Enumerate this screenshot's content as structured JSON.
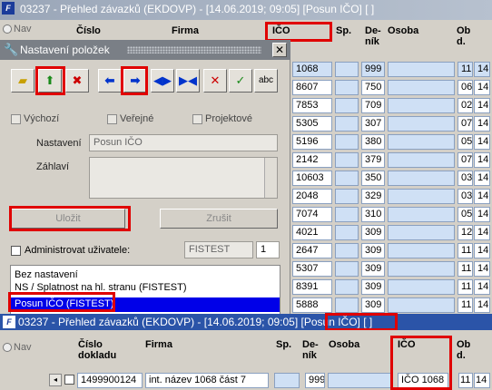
{
  "top_window": {
    "title": "03237 - Přehled závazků (EKDOVP) - [14.06.2019; 09:05] [Posun IČO] [ ]",
    "nav_label": "Nav",
    "columns": {
      "cislo": "Číslo",
      "firma": "Firma",
      "ico": "IČO",
      "sp": "Sp.",
      "den": "De-",
      "den2": "ník",
      "osoba": "Osoba",
      "ob": "Ob",
      "ob2": "d."
    },
    "rows": [
      {
        "den": "999",
        "ob": "11",
        "ob2": "14",
        "firma_tail": "1068"
      },
      {
        "den": "750",
        "ob": "06",
        "ob2": "14",
        "firma_tail": "8607"
      },
      {
        "den": "709",
        "ob": "02",
        "ob2": "14",
        "firma_tail": "7853"
      },
      {
        "den": "307",
        "ob": "07",
        "ob2": "14",
        "firma_tail": "5305"
      },
      {
        "den": "380",
        "ob": "05",
        "ob2": "14",
        "firma_tail": "5196"
      },
      {
        "den": "379",
        "ob": "07",
        "ob2": "14",
        "firma_tail": "2142"
      },
      {
        "den": "350",
        "ob": "03",
        "ob2": "14",
        "firma_tail": "10603"
      },
      {
        "den": "329",
        "ob": "03",
        "ob2": "14",
        "firma_tail": "2048"
      },
      {
        "den": "310",
        "ob": "05",
        "ob2": "14",
        "firma_tail": "7074"
      },
      {
        "den": "309",
        "ob": "12",
        "ob2": "14",
        "firma_tail": "4021"
      },
      {
        "den": "309",
        "ob": "11",
        "ob2": "14",
        "firma_tail": "2647"
      },
      {
        "den": "309",
        "ob": "11",
        "ob2": "14",
        "firma_tail": "5307"
      },
      {
        "den": "309",
        "ob": "11",
        "ob2": "14",
        "firma_tail": "8391"
      },
      {
        "den": "309",
        "ob": "11",
        "ob2": "14",
        "firma_tail": "5888"
      }
    ]
  },
  "dialog": {
    "title": "Nastavení položek",
    "close_symbol": "✕",
    "toolbar": {
      "abc_label": "abc"
    },
    "checks": {
      "vychozi": "Výchozí",
      "verejne": "Veřejné",
      "projektove": "Projektové"
    },
    "nastaveni_label": "Nastavení",
    "nastaveni_value": "Posun IČO",
    "zahlavi_label": "Záhlaví",
    "save_label": "Uložit",
    "cancel_label": "Zrušit",
    "admin_label": "Administrovat uživatele:",
    "admin_user": "FISTEST",
    "admin_num": "1",
    "list": [
      "Bez nastavení",
      "NS / Splatnost na hl. stranu   (FISTEST)",
      "Posun IČO   (FISTEST)"
    ]
  },
  "bottom_window": {
    "title": "03237 - Přehled závazků (EKDOVP) - [14.06.2019; 09:05] [Posun IČO] [ ]",
    "nav_label": "Nav",
    "columns": {
      "cislo": "Číslo",
      "doklad": "dokladu",
      "firma": "Firma",
      "sp": "Sp.",
      "den": "De-",
      "den2": "ník",
      "osoba": "Osoba",
      "ico": "IČO",
      "ob": "Ob",
      "ob2": "d."
    },
    "row": {
      "cislo": "1499900124",
      "firma": "int. název 1068 část 7",
      "den": "999",
      "ico": "IČO 1068",
      "ob": "11",
      "ob2": "14"
    }
  }
}
